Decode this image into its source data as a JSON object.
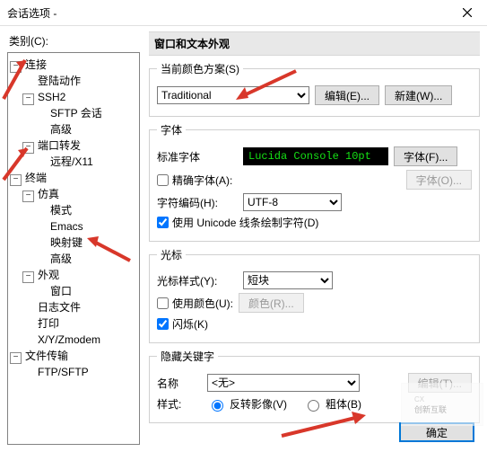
{
  "window": {
    "title": "会话选项 -"
  },
  "category_label": "类别(C):",
  "tree": {
    "connection": "连接",
    "login": "登陆动作",
    "ssh2": "SSH2",
    "sftp_session": "SFTP 会话",
    "advanced1": "高级",
    "port_forward": "端口转发",
    "remote_x11": "远程/X11",
    "terminal": "终端",
    "emulation": "仿真",
    "mode": "模式",
    "emacs": "Emacs",
    "map_keys": "映射键",
    "advanced2": "高级",
    "appearance": "外观",
    "window": "窗口",
    "log_files": "日志文件",
    "print": "打印",
    "xyz": "X/Y/Zmodem",
    "file_transfer": "文件传输",
    "ftp_sftp": "FTP/SFTP"
  },
  "header": "窗口和文本外观",
  "scheme": {
    "legend": "当前颜色方案(S)",
    "value": "Traditional",
    "edit": "编辑(E)...",
    "new": "新建(W)..."
  },
  "font": {
    "legend": "字体",
    "standard_label": "标准字体",
    "sample": "Lucida Console 10pt",
    "font_btn": "字体(F)...",
    "precise_cb": "精确字体(A):",
    "font_btn2": "字体(O)...",
    "encoding_label": "字符编码(H):",
    "encoding_value": "UTF-8",
    "unicode_cb": "使用 Unicode 线条绘制字符(D)"
  },
  "cursor": {
    "legend": "光标",
    "style_label": "光标样式(Y):",
    "style_value": "短块",
    "use_color_cb": "使用颜色(U):",
    "color_btn": "颜色(R)...",
    "blink_cb": "闪烁(K)"
  },
  "hidden": {
    "legend": "隐藏关键字",
    "name_label": "名称",
    "name_value": "<无>",
    "edit_btn": "编辑(T)...",
    "style_label": "样式:",
    "radio_invert": "反转影像(V)",
    "radio_bold": "粗体(B)"
  },
  "footer": {
    "ok": "确定"
  },
  "watermark": "创新互联"
}
